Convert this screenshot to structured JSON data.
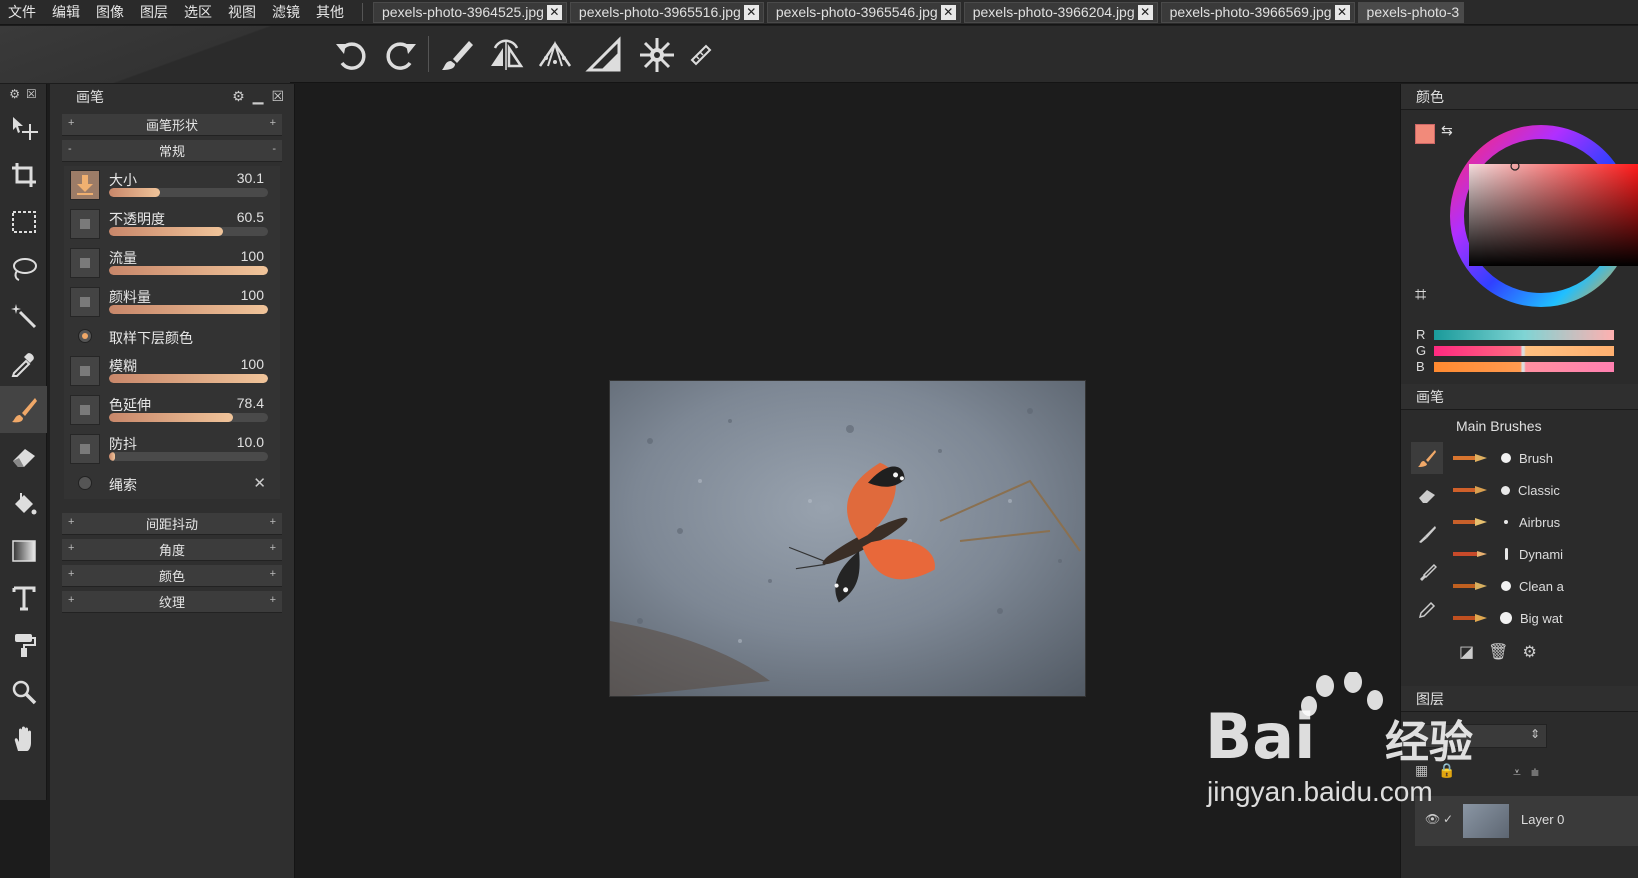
{
  "menu": [
    "文件",
    "编辑",
    "图像",
    "图层",
    "选区",
    "视图",
    "滤镜",
    "其他"
  ],
  "tabs": [
    {
      "label": "pexels-photo-3964525.jpg"
    },
    {
      "label": "pexels-photo-3965516.jpg"
    },
    {
      "label": "pexels-photo-3965546.jpg"
    },
    {
      "label": "pexels-photo-3966204.jpg"
    },
    {
      "label": "pexels-photo-3966569.jpg"
    },
    {
      "label": "pexels-photo-3"
    }
  ],
  "tab_close_glyph": "✕",
  "options_icons": [
    "undo-icon",
    "redo-icon",
    "brush-icon",
    "symmetry-icon",
    "perspective-icon",
    "ruler-icon",
    "mandala-icon",
    "pencil-ruler-icon"
  ],
  "toolbox_icons": [
    "move-icon",
    "crop-icon",
    "rect-select-icon",
    "lasso-icon",
    "magic-wand-icon",
    "eyedropper-icon",
    "brush-icon",
    "eraser-icon",
    "fill-icon",
    "gradient-icon",
    "text-icon",
    "smudge-icon",
    "zoom-icon",
    "hand-icon"
  ],
  "brush_panel": {
    "title": "画笔",
    "sections_top": {
      "brush_shape": "画笔形状",
      "general": "常规"
    },
    "sliders": [
      {
        "label": "大小",
        "value": "30.1",
        "fill": 0.32
      },
      {
        "label": "不透明度",
        "value": "60.5",
        "fill": 0.72
      },
      {
        "label": "流量",
        "value": "100",
        "fill": 1.0
      },
      {
        "label": "颜料量",
        "value": "100",
        "fill": 1.0
      }
    ],
    "radio_sample": "取样下层颜色",
    "sliders2": [
      {
        "label": "模糊",
        "value": "100",
        "fill": 1.0
      },
      {
        "label": "色延伸",
        "value": "78.4",
        "fill": 0.78
      },
      {
        "label": "防抖",
        "value": "10.0",
        "fill": 0.04
      }
    ],
    "radio_rope": "绳索",
    "sections_bottom": [
      "间距抖动",
      "角度",
      "颜色",
      "纹理"
    ]
  },
  "color_panel": {
    "title": "颜色",
    "labels": {
      "r": "R",
      "g": "G",
      "b": "B"
    }
  },
  "brush_library": {
    "title": "画笔",
    "group": "Main Brushes",
    "items": [
      "Brush",
      "Classic",
      "Airbrus",
      "Dynami",
      "Clean a",
      "Big wat"
    ]
  },
  "layers_panel": {
    "title": "图层",
    "layer_name": "Layer 0"
  },
  "watermark": {
    "brand": "Bai",
    "brand2": "经验",
    "url": "jingyan.baidu.com"
  },
  "colors": {
    "accent": "#f0a868",
    "swatch": "#f28a7a"
  }
}
